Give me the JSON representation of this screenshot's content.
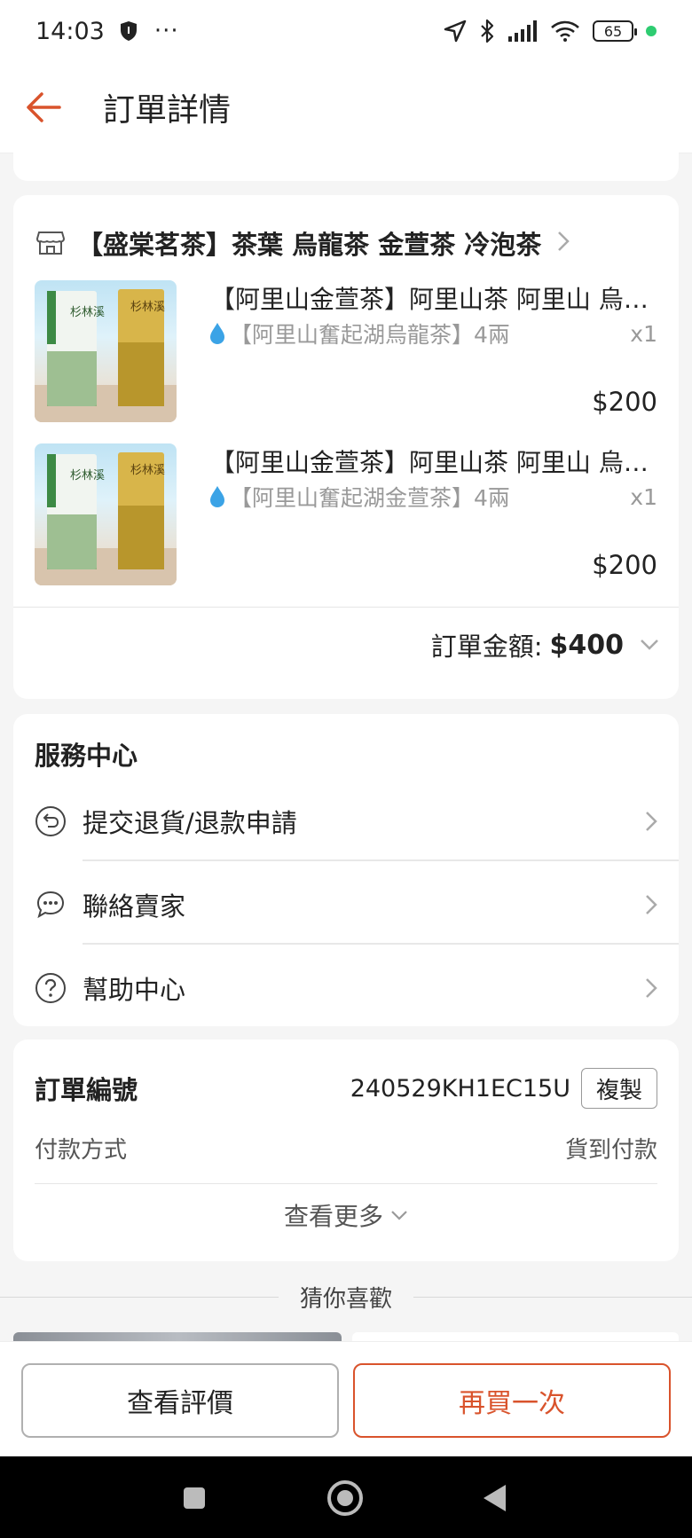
{
  "status_bar": {
    "time": "14:03",
    "dots": "···",
    "battery": "65"
  },
  "header": {
    "title": "訂單詳情"
  },
  "shop": {
    "name": "【盛棠茗茶】茶葉 烏龍茶 金萱茶 冷泡茶"
  },
  "products": [
    {
      "title": "【阿里山金萱茶】阿里山茶 阿里山 烏龍茶",
      "variant": "【阿里山奮起湖烏龍茶】4兩",
      "qty": "x1",
      "price": "$200"
    },
    {
      "title": "【阿里山金萱茶】阿里山茶 阿里山 烏龍茶",
      "variant": "【阿里山奮起湖金萱茶】4兩",
      "qty": "x1",
      "price": "$200"
    }
  ],
  "order_total": {
    "label": "訂單金額:",
    "value": "$400"
  },
  "service_center": {
    "title": "服務中心",
    "items": [
      {
        "label": "提交退貨/退款申請"
      },
      {
        "label": "聯絡賣家"
      },
      {
        "label": "幫助中心"
      }
    ]
  },
  "order_info": {
    "order_no_label": "訂單編號",
    "order_no_value": "240529KH1EC15U",
    "copy_label": "複製",
    "payment_label": "付款方式",
    "payment_value": "貨到付款",
    "more_label": "查看更多"
  },
  "recommend": {
    "title": "猜你喜歡"
  },
  "bottom_actions": {
    "review_label": "查看評價",
    "buy_again_label": "再買一次"
  },
  "colors": {
    "accent": "#d9532c",
    "background": "#f5f5f5",
    "card": "#ffffff"
  }
}
